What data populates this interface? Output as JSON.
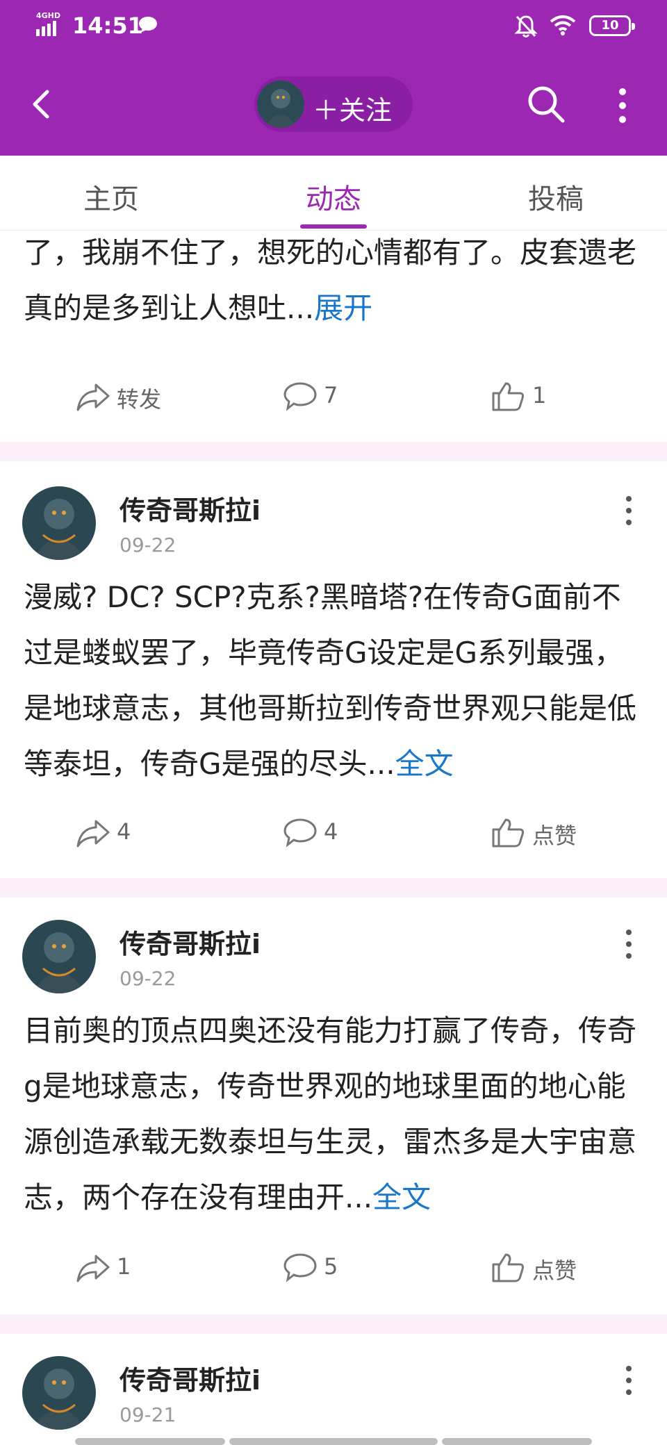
{
  "status_bar": {
    "network": "4GHD",
    "time": "14:51",
    "battery": "10",
    "icons": [
      "signal-icon",
      "chat-bubble-icon",
      "mute-bell-icon",
      "wifi-icon",
      "battery-icon"
    ]
  },
  "header": {
    "follow_label": "＋关注",
    "icons": [
      "back-icon",
      "search-icon",
      "more-icon"
    ]
  },
  "tabs": [
    {
      "label": "主页",
      "active": false
    },
    {
      "label": "动态",
      "active": true
    },
    {
      "label": "投稿",
      "active": false
    }
  ],
  "colors": {
    "accent": "#9b27b3",
    "link": "#1a76c9",
    "separator": "#fbf0fa"
  },
  "posts": [
    {
      "partial_text": "了，我崩不住了，想死的心情都有了。皮套遗老真的是多到让人想吐...",
      "more": "展开",
      "actions": {
        "share": "转发",
        "comment": "7",
        "like": "1"
      }
    },
    {
      "author": "传奇哥斯拉i",
      "date": "09-22",
      "text": "漫威? DC? SCP?克系?黑暗塔?在传奇G面前不过是蝼蚁罢了，毕竟传奇G设定是G系列最强，是地球意志，其他哥斯拉到传奇世界观只能是低等泰坦，传奇G是强的尽头...",
      "more": "全文",
      "actions": {
        "share": "4",
        "comment": "4",
        "like": "点赞"
      }
    },
    {
      "author": "传奇哥斯拉i",
      "date": "09-22",
      "text": "目前奥的顶点四奥还没有能力打赢了传奇，传奇g是地球意志，传奇世界观的地球里面的地心能源创造承载无数泰坦与生灵，雷杰多是大宇宙意志，两个存在没有理由开...",
      "more": "全文",
      "actions": {
        "share": "1",
        "comment": "5",
        "like": "点赞"
      }
    },
    {
      "author": "传奇哥斯拉i",
      "date": "09-21"
    }
  ]
}
